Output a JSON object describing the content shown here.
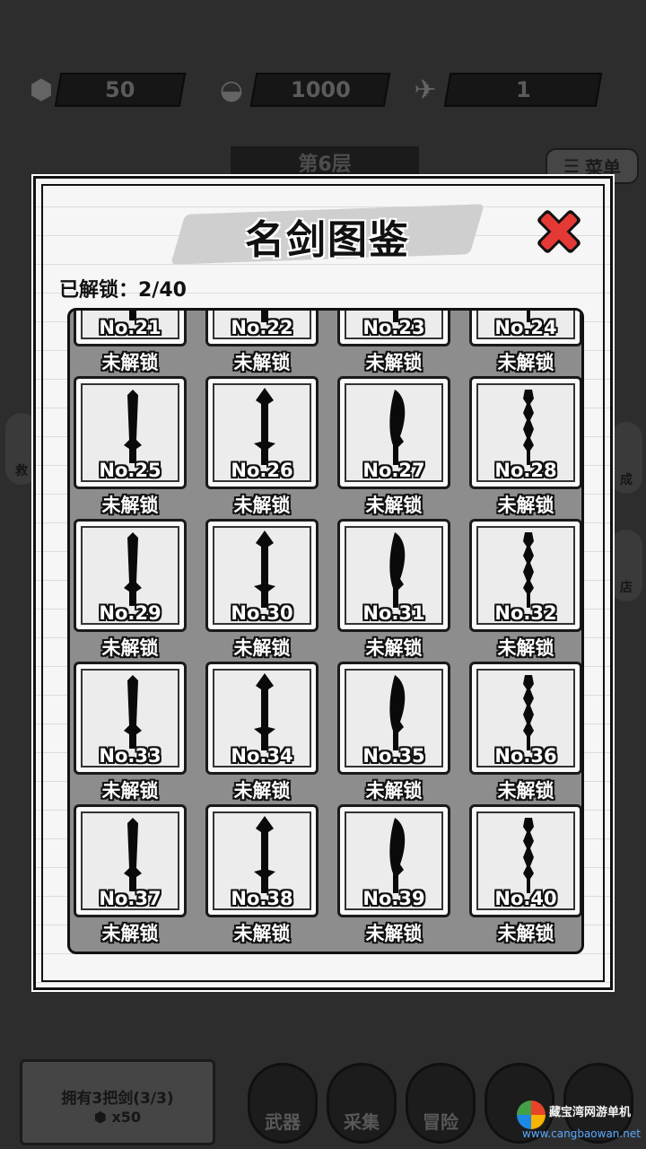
{
  "resources": [
    {
      "icon": "coin-icon",
      "value": "50"
    },
    {
      "icon": "gold-ingot-icon",
      "value": "1000"
    },
    {
      "icon": "paper-crane-icon",
      "value": "1"
    }
  ],
  "floor_label": "第6层",
  "menu_label": "菜单",
  "side_labels": {
    "left_1": "救",
    "right_1": "成",
    "right_2": "店"
  },
  "modal": {
    "title": "名剑图鉴",
    "unlock_text": "已解锁：2/40",
    "cards": [
      {
        "no": "No.21",
        "status": "未解锁"
      },
      {
        "no": "No.22",
        "status": "未解锁"
      },
      {
        "no": "No.23",
        "status": "未解锁"
      },
      {
        "no": "No.24",
        "status": "未解锁"
      },
      {
        "no": "No.25",
        "status": "未解锁"
      },
      {
        "no": "No.26",
        "status": "未解锁"
      },
      {
        "no": "No.27",
        "status": "未解锁"
      },
      {
        "no": "No.28",
        "status": "未解锁"
      },
      {
        "no": "No.29",
        "status": "未解锁"
      },
      {
        "no": "No.30",
        "status": "未解锁"
      },
      {
        "no": "No.31",
        "status": "未解锁"
      },
      {
        "no": "No.32",
        "status": "未解锁"
      },
      {
        "no": "No.33",
        "status": "未解锁"
      },
      {
        "no": "No.34",
        "status": "未解锁"
      },
      {
        "no": "No.35",
        "status": "未解锁"
      },
      {
        "no": "No.36",
        "status": "未解锁"
      },
      {
        "no": "No.37",
        "status": "未解锁"
      },
      {
        "no": "No.38",
        "status": "未解锁"
      },
      {
        "no": "No.39",
        "status": "未解锁"
      },
      {
        "no": "No.40",
        "status": "未解锁"
      }
    ]
  },
  "bottom": {
    "owned_text": "拥有3把剑(3/3)",
    "coin_count": "x50",
    "nav": [
      "武器",
      "采集",
      "冒险"
    ]
  },
  "watermark": {
    "cn": "藏宝湾网游单机",
    "url": "www.cangbaowan.net"
  }
}
